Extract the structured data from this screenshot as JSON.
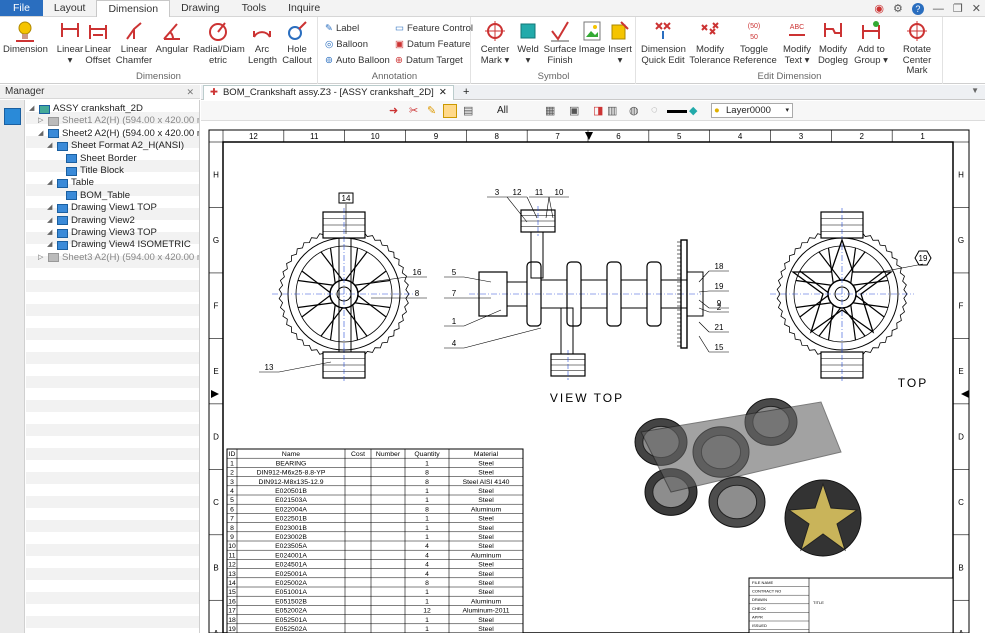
{
  "menubar": {
    "tabs": [
      {
        "label": "File"
      },
      {
        "label": "Layout"
      },
      {
        "label": "Dimension"
      },
      {
        "label": "Drawing"
      },
      {
        "label": "Tools"
      },
      {
        "label": "Inquire"
      }
    ],
    "active": 2,
    "help_icon": "?"
  },
  "ribbon": {
    "groups": [
      {
        "label": "Dimension"
      },
      {
        "label": "Annotation"
      },
      {
        "label": "Symbol"
      },
      {
        "label": "Edit Dimension"
      }
    ],
    "dimension": [
      "Dimension",
      "Linear",
      "Linear Offset",
      "Linear Chamfer",
      "Angular",
      "Radial/Diam etric",
      "Arc Length",
      "Hole Callout"
    ],
    "annotation": [
      "Label",
      "Balloon",
      "Auto Balloon",
      "Feature Control",
      "Datum Feature",
      "Datum Target"
    ],
    "symbol": [
      "Center Mark",
      "Weld",
      "Surface Finish",
      "Image",
      "Insert"
    ],
    "edit": [
      "Dimension Quick Edit",
      "Modify Tolerance",
      "Toggle Reference",
      "Modify Text",
      "Modify Dogleg",
      "Add to Group",
      "Rotate Center Mark"
    ]
  },
  "manager": {
    "title": "Manager",
    "close": "✕",
    "tree": [
      {
        "label": "ASSY crankshaft_2D",
        "level": 0,
        "dim": false
      },
      {
        "label": "Sheet1 A2(H) (594.00 x 420.00 mm)",
        "level": 1,
        "dim": true
      },
      {
        "label": "Sheet2 A2(H) (594.00 x 420.00 mm)",
        "level": 1,
        "dim": false
      },
      {
        "label": "Sheet Format A2_H(ANSI)",
        "level": 2,
        "dim": false
      },
      {
        "label": "Sheet Border",
        "level": 3,
        "dim": false
      },
      {
        "label": "Title Block",
        "level": 3,
        "dim": false
      },
      {
        "label": "Table",
        "level": 2,
        "dim": false
      },
      {
        "label": "BOM_Table",
        "level": 3,
        "dim": false
      },
      {
        "label": "Drawing View1 TOP",
        "level": 2,
        "dim": false
      },
      {
        "label": "Drawing View2",
        "level": 2,
        "dim": false
      },
      {
        "label": "Drawing View3 TOP",
        "level": 2,
        "dim": false
      },
      {
        "label": "Drawing View4 ISOMETRIC",
        "level": 2,
        "dim": false
      },
      {
        "label": "Sheet3 A2(H) (594.00 x 420.00 mm)",
        "level": 1,
        "dim": true
      }
    ]
  },
  "doc": {
    "tab": "BOM_Crankshaft assy.Z3 - [ASSY crankshaft_2D]",
    "filter": "All",
    "layer": "Layer0000"
  },
  "sheet": {
    "cols_top": [
      "12",
      "11",
      "10",
      "9",
      "8",
      "7",
      "6",
      "5",
      "4",
      "3",
      "2",
      "1"
    ],
    "rows": [
      "H",
      "G",
      "F",
      "E",
      "D",
      "C",
      "B",
      "A"
    ],
    "view_top_label": "VIEW TOP",
    "top_label": "TOP",
    "balloons": [
      "14",
      "3",
      "12",
      "11",
      "10",
      "16",
      "8",
      "5",
      "7",
      "1",
      "4",
      "13",
      "18",
      "19",
      "9",
      "2",
      "21",
      "15",
      "19"
    ]
  },
  "bom": {
    "headers": [
      "ID",
      "Name",
      "Cost",
      "Number",
      "Quantity",
      "Material"
    ],
    "rows": [
      [
        "1",
        "BEARING",
        "",
        "",
        "1",
        "Steel"
      ],
      [
        "2",
        "DIN912-M6x25-8.8-YP",
        "",
        "",
        "8",
        "Steel"
      ],
      [
        "3",
        "DIN912-M8x135-12.9",
        "",
        "",
        "8",
        "Steel AISI 4140"
      ],
      [
        "4",
        "E020501B",
        "",
        "",
        "1",
        "Steel"
      ],
      [
        "5",
        "E021503A",
        "",
        "",
        "1",
        "Steel"
      ],
      [
        "6",
        "E022004A",
        "",
        "",
        "8",
        "Aluminum"
      ],
      [
        "7",
        "E022501B",
        "",
        "",
        "1",
        "Steel"
      ],
      [
        "8",
        "E023001B",
        "",
        "",
        "1",
        "Steel"
      ],
      [
        "9",
        "E023002B",
        "",
        "",
        "1",
        "Steel"
      ],
      [
        "10",
        "E023505A",
        "",
        "",
        "4",
        "Steel"
      ],
      [
        "11",
        "E024001A",
        "",
        "",
        "4",
        "Aluminum"
      ],
      [
        "12",
        "E024501A",
        "",
        "",
        "4",
        "Steel"
      ],
      [
        "13",
        "E025001A",
        "",
        "",
        "4",
        "Steel"
      ],
      [
        "14",
        "E025002A",
        "",
        "",
        "8",
        "Steel"
      ],
      [
        "15",
        "E051001A",
        "",
        "",
        "1",
        "Steel"
      ],
      [
        "16",
        "E051502B",
        "",
        "",
        "1",
        "Aluminum"
      ],
      [
        "17",
        "E052002A",
        "",
        "",
        "12",
        "Aluminum-2011"
      ],
      [
        "18",
        "E052501A",
        "",
        "",
        "1",
        "Steel"
      ],
      [
        "19",
        "E052502A",
        "",
        "",
        "1",
        "Steel"
      ]
    ]
  },
  "titleblock": {
    "labels": [
      "FILE NAME",
      "CONTRACT NO",
      "DRAWN",
      "CHECK",
      "APPR",
      "ISSUED"
    ],
    "title": "TITLE"
  }
}
